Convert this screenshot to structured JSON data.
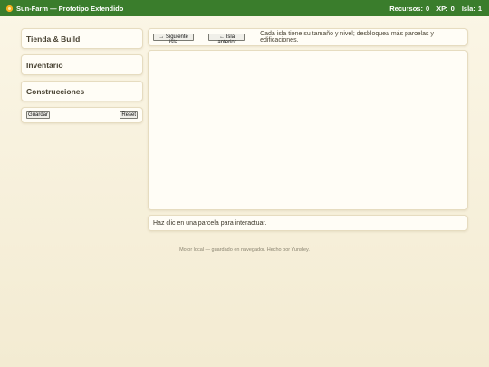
{
  "header": {
    "title": "Sun-Farm — Prototipo Extendido",
    "logo_icon": "sun-icon",
    "resources_label": "Recursos:",
    "resources_value": "0",
    "xp_label": "XP:",
    "xp_value": "0",
    "island_label": "Isla:",
    "island_value": "1",
    "bar_color": "#3a7d2c"
  },
  "sidebar": {
    "sections": [
      {
        "label": "Tienda & Build"
      },
      {
        "label": "Inventario"
      },
      {
        "label": "Construcciones"
      }
    ],
    "save_label": "Guardar",
    "reset_label": "Reset"
  },
  "toolbar": {
    "next_island_label": "→ Siguiente isla",
    "prev_island_label": "← Isla anterior",
    "hint": "Cada isla tiene su tamaño y nivel; desbloquea más parcelas y edificaciones."
  },
  "status": {
    "message": "Haz clic en una parcela para interactuar."
  },
  "footer": {
    "text": "Motor local — guardado en navegador. Hecho por Yunsley."
  }
}
